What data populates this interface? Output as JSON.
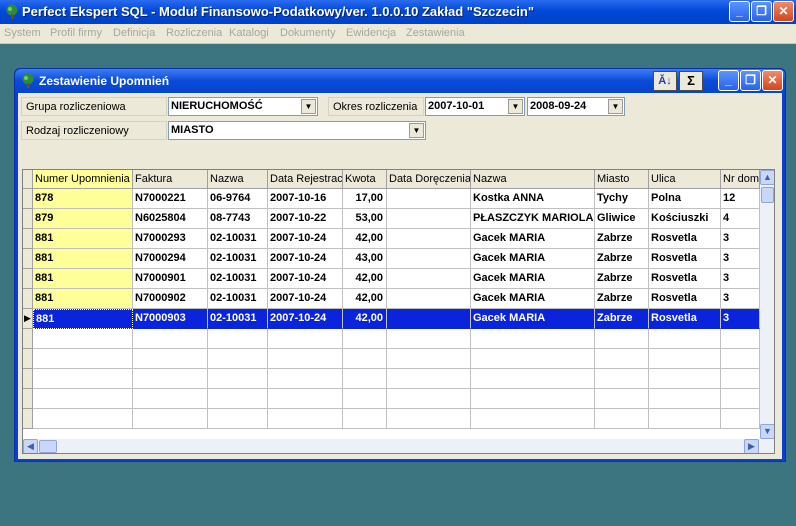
{
  "app": {
    "title": "Perfect Ekspert SQL - Moduł Finansowo-Podatkowy/ver. 1.0.0.10 Zakład \"Szczecin\""
  },
  "window_controls": {
    "minimize": "_",
    "maximize": "❐",
    "close": "✕"
  },
  "menu": [
    "System",
    "Profil firmy",
    "Definicja",
    "Rozliczenia",
    "Katalogi",
    "Dokumenty",
    "Ewidencja",
    "Zestawienia"
  ],
  "child": {
    "title": "Zestawienie Upomnień",
    "sort_button": "Ă↓",
    "sum_button": "Σ",
    "minimize": "_",
    "maximize": "❐",
    "close": "✕"
  },
  "filters": {
    "grupa_label": "Grupa rozliczeniowa",
    "grupa_value": "NIERUCHOMOŚĆ",
    "okres_label": "Okres rozliczenia",
    "date_from": "2007-10-01",
    "date_to": "2008-09-24",
    "rodzaj_label": "Rodzaj rozliczeniowy",
    "rodzaj_value": "MIASTO"
  },
  "grid": {
    "columns": [
      "Numer Upomnienia",
      "Faktura",
      "Nazwa",
      "Data Rejestrac",
      "Kwota",
      "Data Doręczenia",
      "Nazwa",
      "Miasto",
      "Ulica",
      "Nr domu"
    ],
    "rows": [
      [
        "878",
        "N7000221",
        "06-9764",
        "2007-10-16",
        "17,00",
        "",
        "Kostka ANNA",
        "Tychy",
        "Polna",
        "12"
      ],
      [
        "879",
        "N6025804",
        "08-7743",
        "2007-10-22",
        "53,00",
        "",
        "PŁASZCZYK MARIOLA",
        "Gliwice",
        "Kościuszki",
        "4"
      ],
      [
        "881",
        "N7000293",
        "02-10031",
        "2007-10-24",
        "42,00",
        "",
        "Gacek MARIA",
        "Zabrze",
        "Rosvetla",
        "3"
      ],
      [
        "881",
        "N7000294",
        "02-10031",
        "2007-10-24",
        "43,00",
        "",
        "Gacek MARIA",
        "Zabrze",
        "Rosvetla",
        "3"
      ],
      [
        "881",
        "N7000901",
        "02-10031",
        "2007-10-24",
        "42,00",
        "",
        "Gacek MARIA",
        "Zabrze",
        "Rosvetla",
        "3"
      ],
      [
        "881",
        "N7000902",
        "02-10031",
        "2007-10-24",
        "42,00",
        "",
        "Gacek MARIA",
        "Zabrze",
        "Rosvetla",
        "3"
      ],
      [
        "881",
        "N7000903",
        "02-10031",
        "2007-10-24",
        "42,00",
        "",
        "Gacek MARIA",
        "Zabrze",
        "Rosvetla",
        "3"
      ]
    ],
    "selected_row": 6,
    "current_row_marker": "▶",
    "scroll_up": "▲",
    "scroll_down": "▼",
    "scroll_left": "◀",
    "scroll_right": "▶"
  },
  "colors": {
    "desktop": "#3c7480",
    "highlight": "#0a24dc",
    "key_column": "#ffff99"
  }
}
